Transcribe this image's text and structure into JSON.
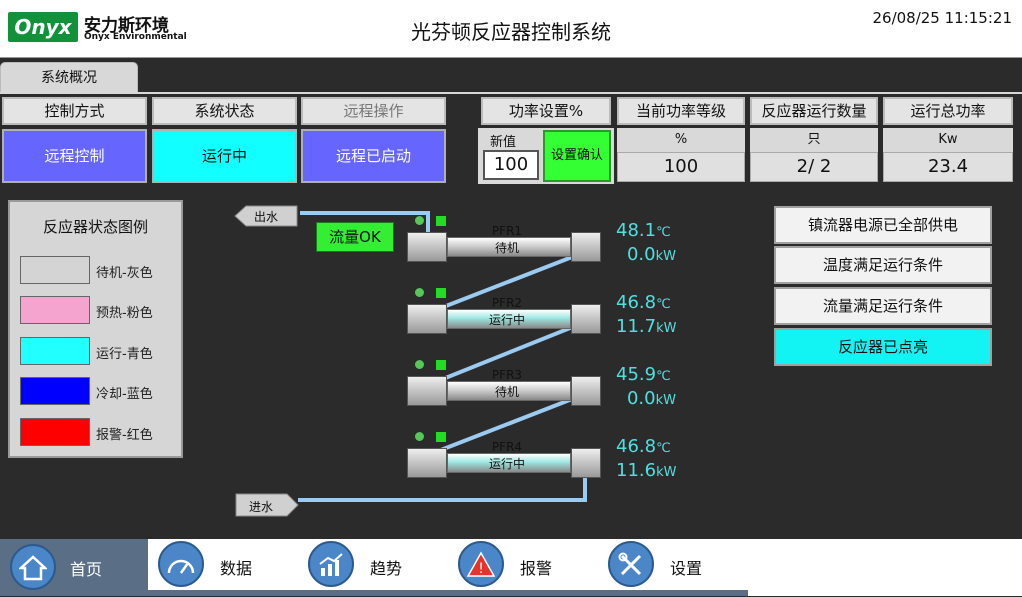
{
  "header": {
    "logo_text": "Onyx",
    "brand_cn": "安力斯环境",
    "brand_en": "Onyx Environmental",
    "title": "光芬顿反应器控制系统",
    "datetime": "26/08/25 11:15:21"
  },
  "tabs": [
    {
      "label": "系统概况"
    }
  ],
  "status": {
    "control_mode": {
      "label": "控制方式",
      "value": "远程控制"
    },
    "system_state": {
      "label": "系统状态",
      "value": "运行中"
    },
    "remote_op": {
      "label": "远程操作",
      "value": "远程已启动"
    }
  },
  "power_setting": {
    "label": "功率设置%",
    "new_value_label": "新值",
    "input_value": "100",
    "confirm_label": "设置确认"
  },
  "metrics": [
    {
      "label": "当前功率等级",
      "unit": "%",
      "value": "100"
    },
    {
      "label": "反应器运行数量",
      "unit": "只",
      "value": "2/ 2"
    },
    {
      "label": "运行总功率",
      "unit": "Kw",
      "value": "23.4"
    }
  ],
  "legend": {
    "title": "反应器状态图例",
    "items": [
      {
        "label": "待机-灰色",
        "color": "#d4d4d4"
      },
      {
        "label": "预热-粉色",
        "color": "#f5a3cf"
      },
      {
        "label": "运行-青色",
        "color": "#22ffff"
      },
      {
        "label": "冷却-蓝色",
        "color": "#0000ff"
      },
      {
        "label": "报警-红色",
        "color": "#ff0000"
      }
    ]
  },
  "flow": {
    "outlet_label": "出水",
    "inlet_label": "进水",
    "flow_status": "流量OK"
  },
  "reactors": [
    {
      "name": "PFR1",
      "state": "待机",
      "temp": "48.1",
      "temp_unit": "℃",
      "power": "0.0",
      "power_unit": "kW",
      "color": "#cfcfcf"
    },
    {
      "name": "PFR2",
      "state": "运行中",
      "temp": "46.8",
      "temp_unit": "℃",
      "power": "11.7",
      "power_unit": "kW",
      "color": "#9de8e2"
    },
    {
      "name": "PFR3",
      "state": "待机",
      "temp": "45.9",
      "temp_unit": "℃",
      "power": "0.0",
      "power_unit": "kW",
      "color": "#cfcfcf"
    },
    {
      "name": "PFR4",
      "state": "运行中",
      "temp": "46.8",
      "temp_unit": "℃",
      "power": "11.6",
      "power_unit": "kW",
      "color": "#9de8e2"
    }
  ],
  "indicators": [
    {
      "label": "镇流器电源已全部供电",
      "color": "#f2f2f2"
    },
    {
      "label": "温度满足运行条件",
      "color": "#f2f2f2"
    },
    {
      "label": "流量满足运行条件",
      "color": "#f2f2f2"
    },
    {
      "label": "反应器已点亮",
      "color": "#12f4f4"
    }
  ],
  "nav": [
    {
      "label": "首页",
      "icon": "home-icon"
    },
    {
      "label": "数据",
      "icon": "gauge-icon"
    },
    {
      "label": "趋势",
      "icon": "trend-icon"
    },
    {
      "label": "报警",
      "icon": "alarm-icon"
    },
    {
      "label": "设置",
      "icon": "tools-icon"
    }
  ],
  "colors": {
    "status_blue": "#6666ff",
    "status_cyan": "#12ffff",
    "confirm_green": "#33ff33",
    "pipe_blue": "#9ccbf2",
    "reading_cyan": "#4ee0e0",
    "nav_active": "#5a6e86"
  }
}
